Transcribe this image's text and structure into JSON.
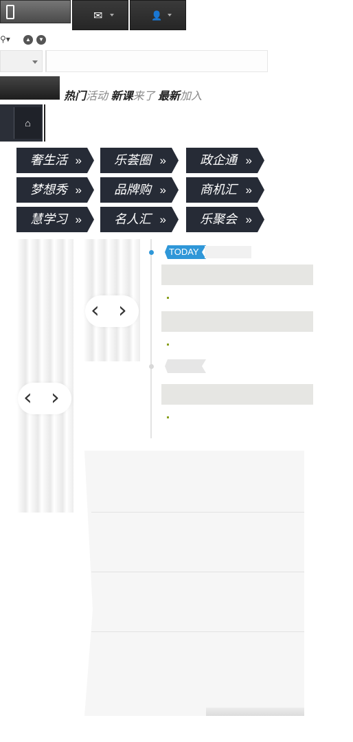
{
  "toolbar": {
    "phone_icon": "mobile-phone-icon",
    "mail_icon": "envelope-icon",
    "user_icon": "user-icon",
    "mail_glyph": "✉",
    "user_glyph": "👤"
  },
  "slogan": {
    "hot_bold": "热门",
    "hot_light": "活动",
    "new_bold": "新课",
    "new_light": "来了",
    "latest_bold": "最新",
    "latest_light": "加入"
  },
  "categories": [
    {
      "label": "奢生活"
    },
    {
      "label": "乐荟圈"
    },
    {
      "label": "政企通"
    },
    {
      "label": "梦想秀"
    },
    {
      "label": "品牌购"
    },
    {
      "label": "商机汇"
    },
    {
      "label": "慧学习"
    },
    {
      "label": "名人汇"
    },
    {
      "label": "乐聚会"
    }
  ],
  "category_arrow": "»",
  "carousel": {
    "prev": "‹",
    "next": "›"
  },
  "timeline": {
    "today_label": "TODAY",
    "accent_color": "#2f97d8"
  }
}
